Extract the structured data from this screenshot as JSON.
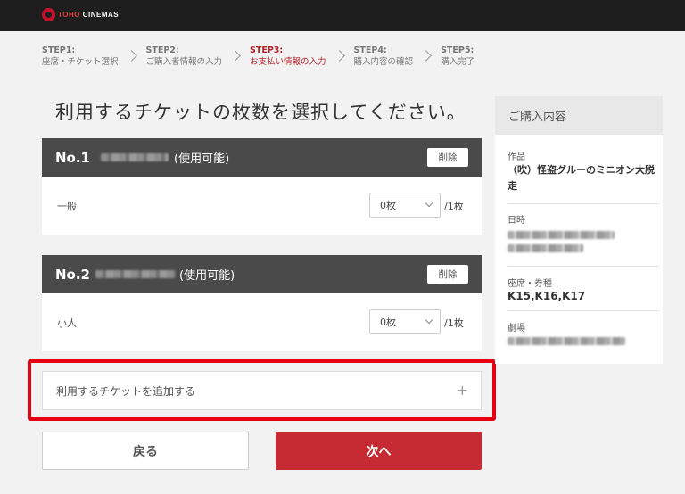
{
  "header": {
    "logo_main": "TOHO",
    "logo_sub": "CINEMAS"
  },
  "steps": [
    {
      "num": "STEP1:",
      "label": "座席・チケット選択",
      "active": false
    },
    {
      "num": "STEP2:",
      "label": "ご購入者情報の入力",
      "active": false
    },
    {
      "num": "STEP3:",
      "label": "お支払い情報の入力",
      "active": true
    },
    {
      "num": "STEP4:",
      "label": "購入内容の確認",
      "active": false
    },
    {
      "num": "STEP5:",
      "label": "購入完了",
      "active": false
    }
  ],
  "main": {
    "title": "利用するチケットの枚数を選択してください。",
    "tickets": [
      {
        "no": "No.1",
        "status": "(使用可能)",
        "delete_label": "削除",
        "type": "一般",
        "qty": "0枚",
        "max": "/1枚"
      },
      {
        "no": "No.2",
        "status": "(使用可能)",
        "delete_label": "削除",
        "type": "小人",
        "qty": "0枚",
        "max": "/1枚"
      }
    ],
    "add_ticket_label": "利用するチケットを追加する",
    "add_icon": "plus-icon"
  },
  "actions": {
    "back_label": "戻る",
    "next_label": "次へ"
  },
  "summary": {
    "title": "ご購入内容",
    "work_label": "作品",
    "work_value": "（吹）怪盗グルーのミニオン大脱走",
    "date_label": "日時",
    "seat_label": "座席・券種",
    "seat_value": "K15,K16,K17",
    "theater_label": "劇場"
  },
  "colors": {
    "accent": "#c62b33",
    "highlight": "#e50012",
    "header_bg": "#1e1e1e",
    "card_head": "#4a4a4a"
  }
}
